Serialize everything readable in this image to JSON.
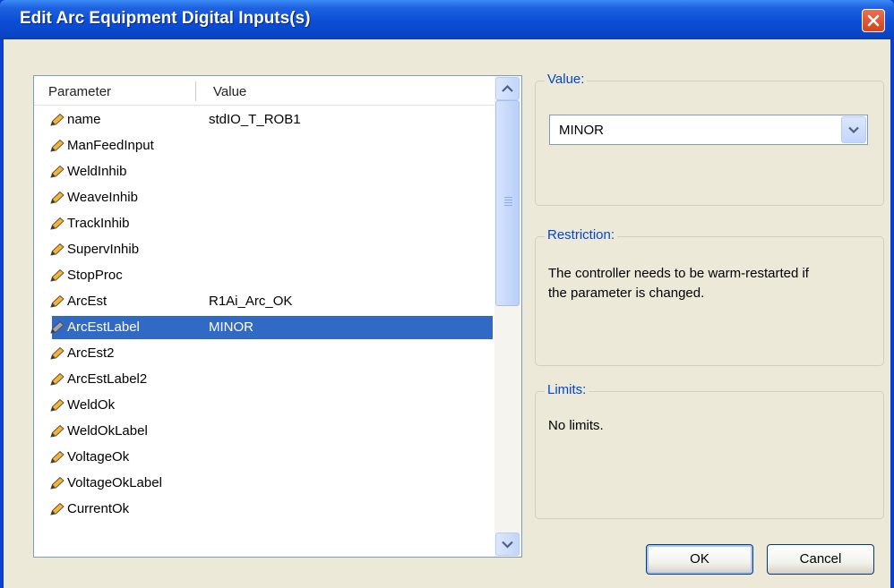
{
  "window": {
    "title": "Edit Arc Equipment Digital Inputs(s)"
  },
  "list": {
    "headers": {
      "parameter": "Parameter",
      "value": "Value"
    },
    "rows": [
      {
        "name": "name",
        "value": "stdIO_T_ROB1"
      },
      {
        "name": "ManFeedInput",
        "value": ""
      },
      {
        "name": "WeldInhib",
        "value": ""
      },
      {
        "name": "WeaveInhib",
        "value": ""
      },
      {
        "name": "TrackInhib",
        "value": ""
      },
      {
        "name": "SupervInhib",
        "value": ""
      },
      {
        "name": "StopProc",
        "value": ""
      },
      {
        "name": "ArcEst",
        "value": "R1Ai_Arc_OK"
      },
      {
        "name": "ArcEstLabel",
        "value": "MINOR",
        "selected": true
      },
      {
        "name": "ArcEst2",
        "value": ""
      },
      {
        "name": "ArcEstLabel2",
        "value": ""
      },
      {
        "name": "WeldOk",
        "value": ""
      },
      {
        "name": "WeldOkLabel",
        "value": ""
      },
      {
        "name": "VoltageOk",
        "value": ""
      },
      {
        "name": "VoltageOkLabel",
        "value": ""
      },
      {
        "name": "CurrentOk",
        "value": ""
      }
    ]
  },
  "value_group": {
    "label": "Value:",
    "selected": "MINOR"
  },
  "restriction_group": {
    "label": "Restriction:",
    "line1": "The controller needs to be warm-restarted if",
    "line2": "the parameter is changed."
  },
  "limits_group": {
    "label": "Limits:",
    "text": "No limits."
  },
  "buttons": {
    "ok": "OK",
    "cancel": "Cancel"
  },
  "icons": {
    "row_icon": "pencil-icon",
    "close": "close-icon"
  },
  "colors": {
    "selection": "#316AC5",
    "group_label": "#0046D5",
    "titlebar": "#0A4ED6"
  }
}
